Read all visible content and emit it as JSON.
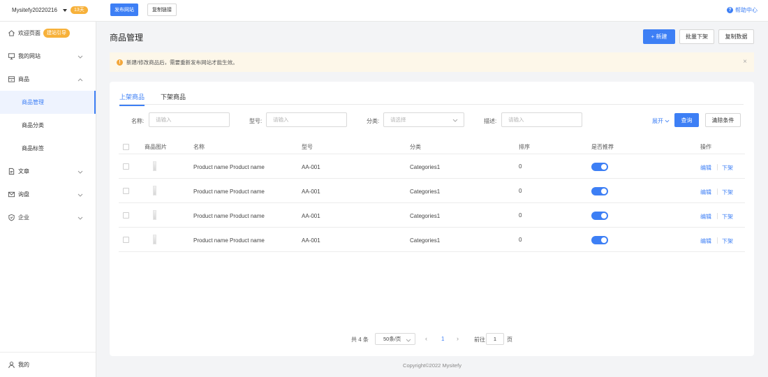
{
  "topbar": {
    "site_name": "Mysitefy20220216",
    "days_badge": "13天",
    "publish_label": "发布网站",
    "copy_link_label": "复制链接",
    "help_label": "帮助中心"
  },
  "sidebar": {
    "welcome": {
      "label": "欢迎页面",
      "badge": "建站引导"
    },
    "my_site": "我的网站",
    "products": "商品",
    "sub_items": [
      "商品管理",
      "商品分类",
      "商品标签"
    ],
    "articles": "文章",
    "inquiry": "询盘",
    "company": "企业",
    "mine": "我的"
  },
  "header": {
    "title": "商品管理",
    "new_label": "新建",
    "bulk_off_label": "批量下架",
    "copy_data_label": "复制数据"
  },
  "notice": {
    "text": "新建/修改商品后，需要重新发布网站才能生效。"
  },
  "tabs": [
    "上架商品",
    "下架商品"
  ],
  "filters": {
    "name_label": "名称:",
    "name_placeholder": "请输入",
    "model_label": "型号:",
    "model_placeholder": "请输入",
    "category_label": "分类:",
    "category_placeholder": "请选择",
    "desc_label": "描述:",
    "desc_placeholder": "请输入",
    "expand_label": "展开",
    "query_label": "查询",
    "clear_label": "清除条件"
  },
  "table": {
    "headers": {
      "image": "商品图片",
      "name": "名称",
      "model": "型号",
      "category": "分类",
      "sort": "排序",
      "recommend": "是否推荐",
      "actions": "操作"
    },
    "rows": [
      {
        "name": "Product name Product name",
        "model": "AA-001",
        "category": "Categories1",
        "sort": "0",
        "recommend": true
      },
      {
        "name": "Product name Product name",
        "model": "AA-001",
        "category": "Categories1",
        "sort": "0",
        "recommend": true
      },
      {
        "name": "Product name Product name",
        "model": "AA-001",
        "category": "Categories1",
        "sort": "0",
        "recommend": true
      },
      {
        "name": "Product name Product name",
        "model": "AA-001",
        "category": "Categories1",
        "sort": "0",
        "recommend": true
      }
    ],
    "edit_label": "编辑",
    "off_label": "下架"
  },
  "pagination": {
    "total": "共 4 条",
    "page_size": "50条/页",
    "current": "1",
    "goto_label": "前往",
    "goto_value": "1",
    "page_suffix": "页"
  },
  "footer": "Copyright©2022  Mysitefy",
  "colors": {
    "primary": "#3d7ff5",
    "badge": "#f7b13a",
    "notice_bg": "#fdf7e9"
  },
  "icons": [
    "home-icon",
    "monitor-icon",
    "box-icon",
    "file-icon",
    "mail-icon",
    "shield-icon",
    "user-icon",
    "help-icon",
    "warning-icon",
    "close-icon",
    "chevron-down-icon",
    "plus-icon"
  ]
}
